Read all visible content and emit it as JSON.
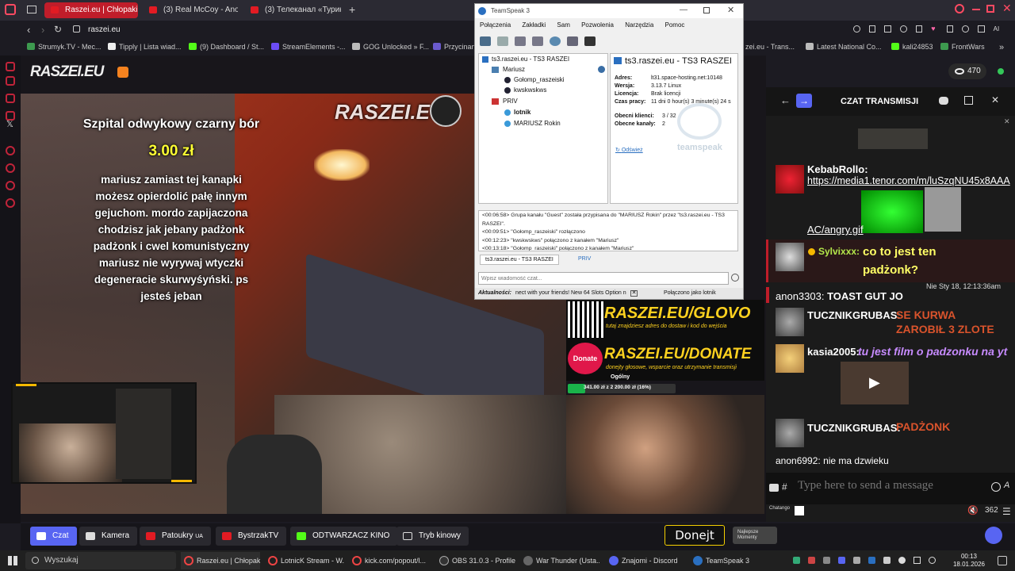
{
  "browser": {
    "tabs": [
      {
        "label": "Raszei.eu | Chłopaki z Ra..."
      },
      {
        "label": "(3) Real McCoy - Another"
      },
      {
        "label": "(3) Телеканал «Турик и К"
      }
    ],
    "url": "raszei.eu",
    "bookmarks": [
      "Strumyk.TV - Mec...",
      "Tipply | Lista wiad...",
      "(9) Dashboard / St...",
      "StreamElements -...",
      "GOG Unlocked » F...",
      "Przycinan",
      "zei.eu - Trans...",
      "Latest National Co...",
      "kali24853",
      "FrontWars"
    ]
  },
  "site": {
    "logo": "RASZEI.EU",
    "viewers": "470",
    "stream_watermark": "RASZEI.EU",
    "overlay": {
      "title": "Szpital odwykowy czarny bór",
      "amount": "3.00 zł",
      "message": "mariusz zamiast tej kanapki możesz opierdolić pałę innym gejuchom. mordo zapijaczona chodzisz jak jebany padżonk padżonk i cwel komunistyczny mariusz nie wyrywaj wtyczki degeneracie skurwyśyński. ps jesteś jeban"
    },
    "promo": {
      "glovo": "RASZEI.EU/GLOVO",
      "glovo_sub": "tutaj znajdziesz adres do dostaw i kod do wejścia",
      "donate_badge": "Donate",
      "donate": "RASZEI.EU/DONATE",
      "donate_sub": "donejty głosowe, wsparcie oraz utrzymanie transmisji",
      "goal_label": "Ogólny",
      "goal_text": "341.00 zł z 2 200.00 zł (16%)",
      "goal_fraction": 0.16
    }
  },
  "chat": {
    "title": "CZAT TRANSMISJI",
    "messages": [
      {
        "user": "KebabRollo:",
        "text": "https://media1.tenor.com/m/luSzqNU45x8AAA",
        "extra": "AC/angry.gif",
        "color": "#ffffff",
        "textcolor": "#ffffff"
      },
      {
        "user": "Sylvixxx:",
        "text": "co to jest ten padżonk?",
        "color": "#b3e74a",
        "textcolor": "#ffff66"
      },
      {
        "timestamp": "Nie Sty 18, 12:13:36am"
      },
      {
        "user": "anon3303:",
        "text": "TOAST GUT JO",
        "color": "#ffffff",
        "textcolor": "#ffffff"
      },
      {
        "user": "TUCZNIKGRUBAS:",
        "text": "SE KURWA ZAROBIŁ 3 ZLOTE",
        "color": "#ffffff",
        "textcolor": "#d9532c"
      },
      {
        "user": "kasia2005:",
        "text": "tu jest film o padzonku na yt",
        "color": "#ffffff",
        "textcolor": "#c78bff"
      },
      {
        "user": "TUCZNIKGRUBAS:",
        "text": "PADŻONK",
        "color": "#ffffff",
        "textcolor": "#d9532c"
      },
      {
        "user": "anon6992:",
        "text": "nie ma dzwieku",
        "color": "#ffffff",
        "textcolor": "#ffffff"
      }
    ],
    "input_placeholder": "Type here to send a message",
    "hash": "#",
    "chatango_label": "Chatango",
    "volume_count": "362"
  },
  "teamspeak": {
    "window_title": "TeamSpeak 3",
    "menu": [
      "Połączenia",
      "Zakładki",
      "Sam",
      "Pozwolenia",
      "Narzędzia",
      "Pomoc"
    ],
    "tree": {
      "server": "ts3.raszei.eu - TS3 RASZEI",
      "channels": [
        {
          "name": "Mariusz",
          "users": [
            "Gołomp_raszeiski",
            "kwskwskws"
          ]
        },
        {
          "name": "PRIV",
          "users": [
            "lotnik",
            "MARIUSZ Rokin"
          ]
        }
      ]
    },
    "info": {
      "title": "ts3.raszei.eu - TS3 RASZEI",
      "rows": [
        {
          "k": "Adres:",
          "v": "lt31.space-hosting.net:10148"
        },
        {
          "k": "Wersja:",
          "v": "3.13.7 Linux"
        },
        {
          "k": "Licencja:",
          "v": "Brak licencji"
        },
        {
          "k": "Czas pracy:",
          "v": "11 dni 0 hour(s) 3 minute(s) 24 s"
        },
        {
          "k": "Obecni klienci:",
          "v": "3 / 32"
        },
        {
          "k": "Obecne kanały:",
          "v": "2"
        }
      ],
      "refresh": "Odśwież",
      "brand": "teamspeak"
    },
    "log": [
      "<00:06:58> Grupa kanału \"Guest\" została przypisana do \"MARIUSZ Rokin\" przez \"ts3.raszei.eu - TS3 RASZEI\".",
      "<00:09:51> \"Gołomp_raszeiski\" rozłączono",
      "<00:12:23> \"kwskwskws\" połączono z kanałem \"Mariusz\"",
      "<00:13:18> \"Gołomp_raszeiski\" połączono z kanałem \"Mariusz\""
    ],
    "tabs": [
      "ts3.raszei.eu - TS3 RASZEI",
      "PRIV"
    ],
    "input_placeholder": "Wpisz wiadomość czat...",
    "status_label": "Aktualności:",
    "status_ticker": "nect with your friends! New 64 Slots Option n",
    "status_connected": "Połączono jako lotnik"
  },
  "bottom_buttons": [
    {
      "label": "Czat"
    },
    {
      "label": "Kamera"
    },
    {
      "label": "Patoukry",
      "sub": "UA"
    },
    {
      "label": "BystrzakTV"
    },
    {
      "label": "ODTWARZACZ KINO"
    },
    {
      "label": "Tryb kinowy"
    }
  ],
  "donejt": "Donejt",
  "najlepsze": "Najlepsze Momenty",
  "taskbar": {
    "search": "Wyszukaj",
    "items": [
      "Raszei.eu | Chłopak...",
      "LotnicK Stream - W...",
      "kick.com/popout/l...",
      "OBS 31.0.3 - Profile:...",
      "War Thunder (Usta...",
      "Znajomi - Discord",
      "TeamSpeak 3"
    ],
    "time": "00:13",
    "date": "18.01.2026"
  },
  "colors": {
    "accent": "#c01d2a",
    "chat_bg": "#1b1b1b",
    "ts_bg": "#f0f0f0"
  }
}
